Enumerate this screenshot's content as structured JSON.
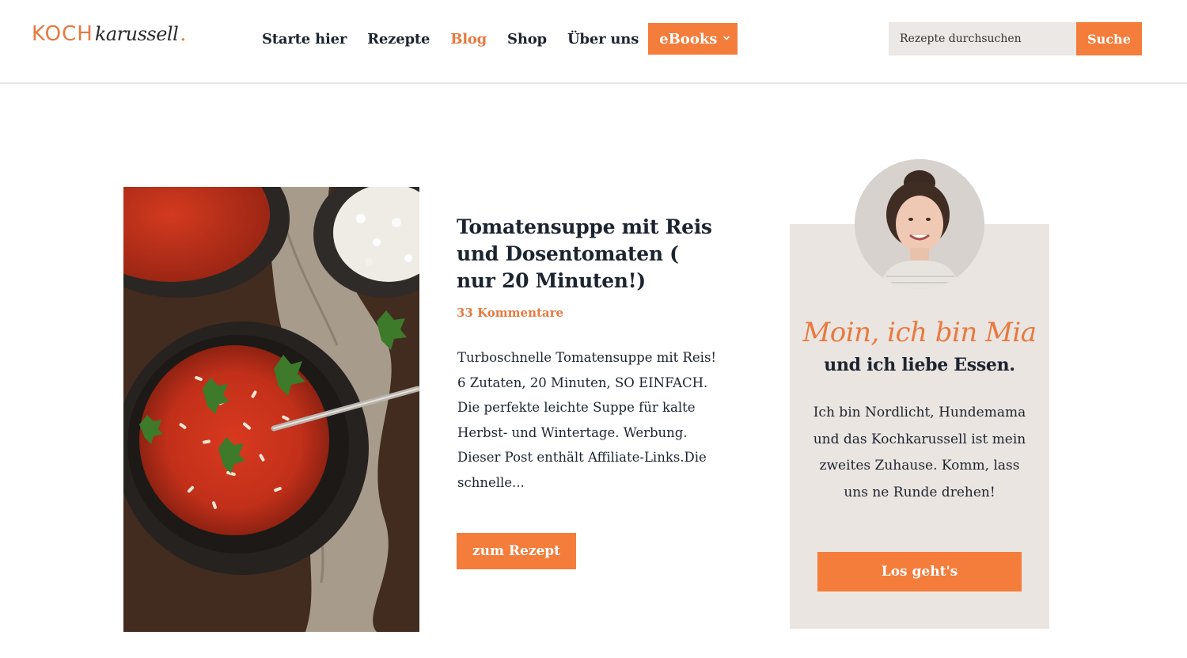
{
  "header": {
    "logo": {
      "part1": "KOCH",
      "part2": "karussell",
      "dot": "."
    },
    "nav": [
      {
        "label": "Starte hier",
        "active": false
      },
      {
        "label": "Rezepte",
        "active": false
      },
      {
        "label": "Blog",
        "active": true
      },
      {
        "label": "Shop",
        "active": false
      },
      {
        "label": "Über uns",
        "active": false
      }
    ],
    "ebooks_label": "eBooks",
    "search": {
      "placeholder": "Rezepte durchsuchen",
      "button_label": "Suche"
    }
  },
  "post": {
    "title": "Tomatensuppe mit Reis und Dosentomaten ( nur 20 Minuten!)",
    "comments": "33 Kommentare",
    "excerpt": "Turboschnelle Tomatensuppe mit Reis! 6 Zutaten, 20 Minuten, SO EINFACH. Die perfekte leichte Suppe für kalte Herbst- und Wintertage. Werbung. Dieser Post enthält Affiliate-Links.Die schnelle...",
    "button_label": "zum Rezept"
  },
  "about": {
    "greeting": "Moin, ich bin Mia",
    "heading": "und ich liebe Essen.",
    "text": "Ich bin Nordlicht, Hundemama und das Kochkarussell ist mein zweites Zuhause. Komm, lass uns ne Runde drehen!",
    "button_label": "Los geht's"
  },
  "colors": {
    "accent": "#f47d3c",
    "accent_text": "#e8793f",
    "dark_text": "#1c2430",
    "box_bg": "#ebe5e1",
    "search_bg": "#ece8e5"
  }
}
